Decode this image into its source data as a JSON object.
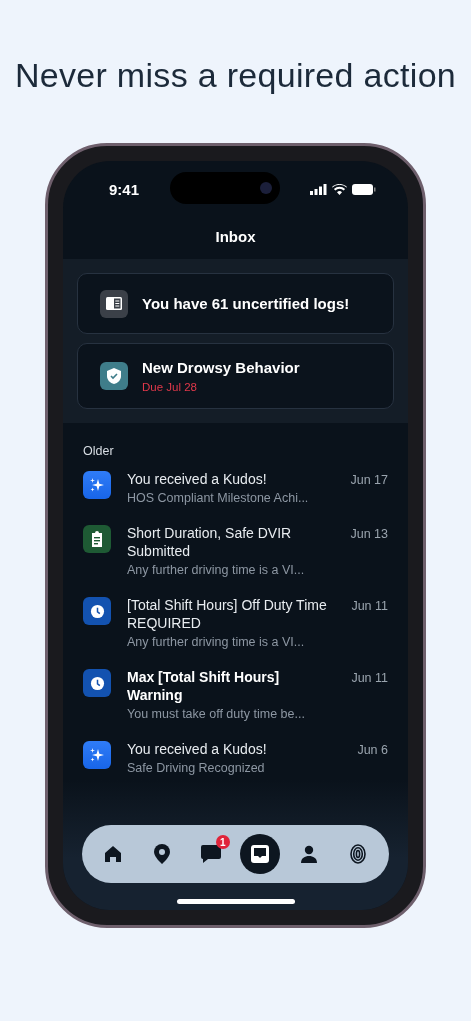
{
  "headline": "Never miss a required action",
  "status_bar": {
    "time": "9:41"
  },
  "title": "Inbox",
  "alerts": [
    {
      "kind": "logs",
      "title": "You have 61 uncertified logs!"
    },
    {
      "kind": "behavior",
      "title": "New Drowsy Behavior",
      "due": "Due Jul 28"
    }
  ],
  "section": "Older",
  "messages": [
    {
      "kind": "kudos",
      "title": "You received a Kudos!",
      "subtitle": "HOS Compliant Milestone Achi...",
      "date": "Jun 17",
      "unread": false
    },
    {
      "kind": "dvir",
      "title": "Short Duration, Safe DVIR Submitted",
      "subtitle": "Any further driving time is a VI...",
      "date": "Jun 13",
      "unread": false
    },
    {
      "kind": "hours",
      "title": "[Total Shift Hours] Off Duty Time REQUIRED",
      "subtitle": "Any further driving time is a VI...",
      "date": "Jun 11",
      "unread": false
    },
    {
      "kind": "hours",
      "title": "Max [Total Shift Hours] Warning",
      "subtitle": "You must take off duty time be...",
      "date": "Jun 11",
      "unread": true
    },
    {
      "kind": "kudos",
      "title": "You received a Kudos!",
      "subtitle": "Safe Driving Recognized",
      "date": "Jun 6",
      "unread": false
    }
  ],
  "nav": [
    {
      "kind": "home",
      "selected": false
    },
    {
      "kind": "location",
      "selected": false
    },
    {
      "kind": "messages",
      "selected": false,
      "badge": "1"
    },
    {
      "kind": "inbox",
      "selected": true
    },
    {
      "kind": "profile",
      "selected": false
    },
    {
      "kind": "fingerprint",
      "selected": false
    }
  ]
}
